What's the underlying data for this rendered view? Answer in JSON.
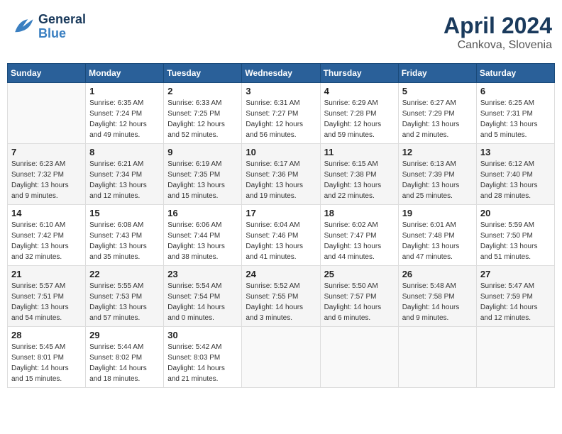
{
  "header": {
    "logo_general": "General",
    "logo_blue": "Blue",
    "month_title": "April 2024",
    "subtitle": "Cankova, Slovenia"
  },
  "weekdays": [
    "Sunday",
    "Monday",
    "Tuesday",
    "Wednesday",
    "Thursday",
    "Friday",
    "Saturday"
  ],
  "weeks": [
    [
      {
        "day": "",
        "info": ""
      },
      {
        "day": "1",
        "info": "Sunrise: 6:35 AM\nSunset: 7:24 PM\nDaylight: 12 hours\nand 49 minutes."
      },
      {
        "day": "2",
        "info": "Sunrise: 6:33 AM\nSunset: 7:25 PM\nDaylight: 12 hours\nand 52 minutes."
      },
      {
        "day": "3",
        "info": "Sunrise: 6:31 AM\nSunset: 7:27 PM\nDaylight: 12 hours\nand 56 minutes."
      },
      {
        "day": "4",
        "info": "Sunrise: 6:29 AM\nSunset: 7:28 PM\nDaylight: 12 hours\nand 59 minutes."
      },
      {
        "day": "5",
        "info": "Sunrise: 6:27 AM\nSunset: 7:29 PM\nDaylight: 13 hours\nand 2 minutes."
      },
      {
        "day": "6",
        "info": "Sunrise: 6:25 AM\nSunset: 7:31 PM\nDaylight: 13 hours\nand 5 minutes."
      }
    ],
    [
      {
        "day": "7",
        "info": "Sunrise: 6:23 AM\nSunset: 7:32 PM\nDaylight: 13 hours\nand 9 minutes."
      },
      {
        "day": "8",
        "info": "Sunrise: 6:21 AM\nSunset: 7:34 PM\nDaylight: 13 hours\nand 12 minutes."
      },
      {
        "day": "9",
        "info": "Sunrise: 6:19 AM\nSunset: 7:35 PM\nDaylight: 13 hours\nand 15 minutes."
      },
      {
        "day": "10",
        "info": "Sunrise: 6:17 AM\nSunset: 7:36 PM\nDaylight: 13 hours\nand 19 minutes."
      },
      {
        "day": "11",
        "info": "Sunrise: 6:15 AM\nSunset: 7:38 PM\nDaylight: 13 hours\nand 22 minutes."
      },
      {
        "day": "12",
        "info": "Sunrise: 6:13 AM\nSunset: 7:39 PM\nDaylight: 13 hours\nand 25 minutes."
      },
      {
        "day": "13",
        "info": "Sunrise: 6:12 AM\nSunset: 7:40 PM\nDaylight: 13 hours\nand 28 minutes."
      }
    ],
    [
      {
        "day": "14",
        "info": "Sunrise: 6:10 AM\nSunset: 7:42 PM\nDaylight: 13 hours\nand 32 minutes."
      },
      {
        "day": "15",
        "info": "Sunrise: 6:08 AM\nSunset: 7:43 PM\nDaylight: 13 hours\nand 35 minutes."
      },
      {
        "day": "16",
        "info": "Sunrise: 6:06 AM\nSunset: 7:44 PM\nDaylight: 13 hours\nand 38 minutes."
      },
      {
        "day": "17",
        "info": "Sunrise: 6:04 AM\nSunset: 7:46 PM\nDaylight: 13 hours\nand 41 minutes."
      },
      {
        "day": "18",
        "info": "Sunrise: 6:02 AM\nSunset: 7:47 PM\nDaylight: 13 hours\nand 44 minutes."
      },
      {
        "day": "19",
        "info": "Sunrise: 6:01 AM\nSunset: 7:48 PM\nDaylight: 13 hours\nand 47 minutes."
      },
      {
        "day": "20",
        "info": "Sunrise: 5:59 AM\nSunset: 7:50 PM\nDaylight: 13 hours\nand 51 minutes."
      }
    ],
    [
      {
        "day": "21",
        "info": "Sunrise: 5:57 AM\nSunset: 7:51 PM\nDaylight: 13 hours\nand 54 minutes."
      },
      {
        "day": "22",
        "info": "Sunrise: 5:55 AM\nSunset: 7:53 PM\nDaylight: 13 hours\nand 57 minutes."
      },
      {
        "day": "23",
        "info": "Sunrise: 5:54 AM\nSunset: 7:54 PM\nDaylight: 14 hours\nand 0 minutes."
      },
      {
        "day": "24",
        "info": "Sunrise: 5:52 AM\nSunset: 7:55 PM\nDaylight: 14 hours\nand 3 minutes."
      },
      {
        "day": "25",
        "info": "Sunrise: 5:50 AM\nSunset: 7:57 PM\nDaylight: 14 hours\nand 6 minutes."
      },
      {
        "day": "26",
        "info": "Sunrise: 5:48 AM\nSunset: 7:58 PM\nDaylight: 14 hours\nand 9 minutes."
      },
      {
        "day": "27",
        "info": "Sunrise: 5:47 AM\nSunset: 7:59 PM\nDaylight: 14 hours\nand 12 minutes."
      }
    ],
    [
      {
        "day": "28",
        "info": "Sunrise: 5:45 AM\nSunset: 8:01 PM\nDaylight: 14 hours\nand 15 minutes."
      },
      {
        "day": "29",
        "info": "Sunrise: 5:44 AM\nSunset: 8:02 PM\nDaylight: 14 hours\nand 18 minutes."
      },
      {
        "day": "30",
        "info": "Sunrise: 5:42 AM\nSunset: 8:03 PM\nDaylight: 14 hours\nand 21 minutes."
      },
      {
        "day": "",
        "info": ""
      },
      {
        "day": "",
        "info": ""
      },
      {
        "day": "",
        "info": ""
      },
      {
        "day": "",
        "info": ""
      }
    ]
  ]
}
